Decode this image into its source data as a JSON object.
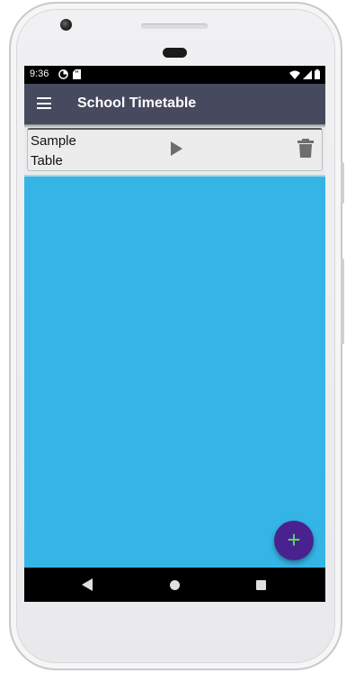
{
  "status_bar": {
    "time": "9:36",
    "left_icons": [
      "data-saver-icon",
      "sd-card-icon"
    ],
    "right_icons": [
      "wifi-icon",
      "signal-icon",
      "battery-icon"
    ]
  },
  "app_bar": {
    "title": "School Timetable",
    "menu_icon": "hamburger-menu-icon"
  },
  "list": {
    "items": [
      {
        "title": "Sample Table",
        "action_icons": [
          "play-icon",
          "delete-icon"
        ]
      }
    ]
  },
  "fab": {
    "label": "+"
  },
  "nav_bar": {
    "icons": [
      "back-icon",
      "home-icon",
      "recents-icon"
    ]
  },
  "colors": {
    "app_bar": "#474a5e",
    "screen_background": "#35b5e5",
    "fab_background": "#4a2290",
    "fab_icon": "#58e05e",
    "list_item_background": "#ececec"
  }
}
